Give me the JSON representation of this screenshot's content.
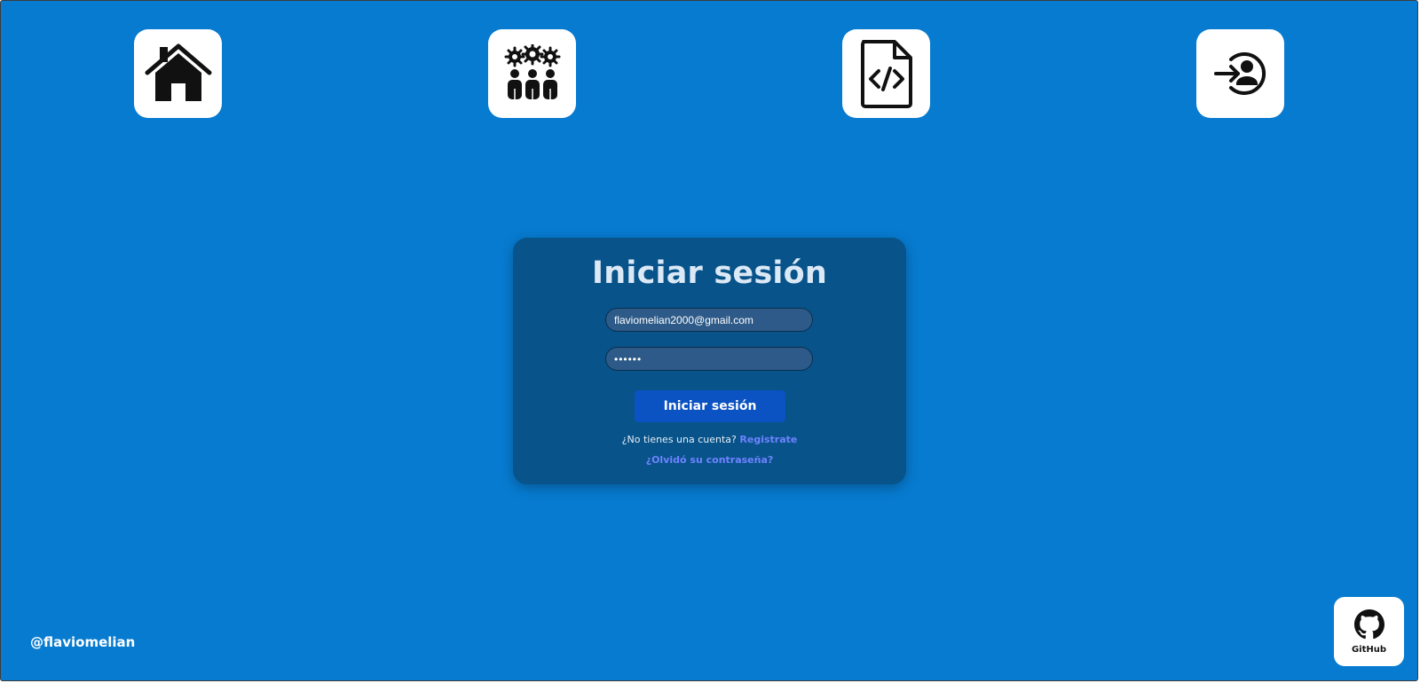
{
  "colors": {
    "background": "#077bd0",
    "card": "#07538a",
    "button": "#0b52c2",
    "link": "#6f83ff",
    "title": "#dbe8f5"
  },
  "nav": {
    "items": [
      {
        "icon": "home-icon"
      },
      {
        "icon": "team-settings-icon"
      },
      {
        "icon": "code-file-icon"
      },
      {
        "icon": "login-user-icon"
      }
    ]
  },
  "login": {
    "title": "Iniciar sesión",
    "email_value": "flaviomelian2000@gmail.com",
    "password_value": "••••••",
    "submit_label": "Iniciar sesión",
    "signup_prompt": "¿No tienes una cuenta?",
    "signup_link": "Registrate",
    "forgot_link": "¿Olvidó su contraseña?"
  },
  "footer": {
    "handle": "@flaviomelian",
    "github_label": "GitHub"
  }
}
